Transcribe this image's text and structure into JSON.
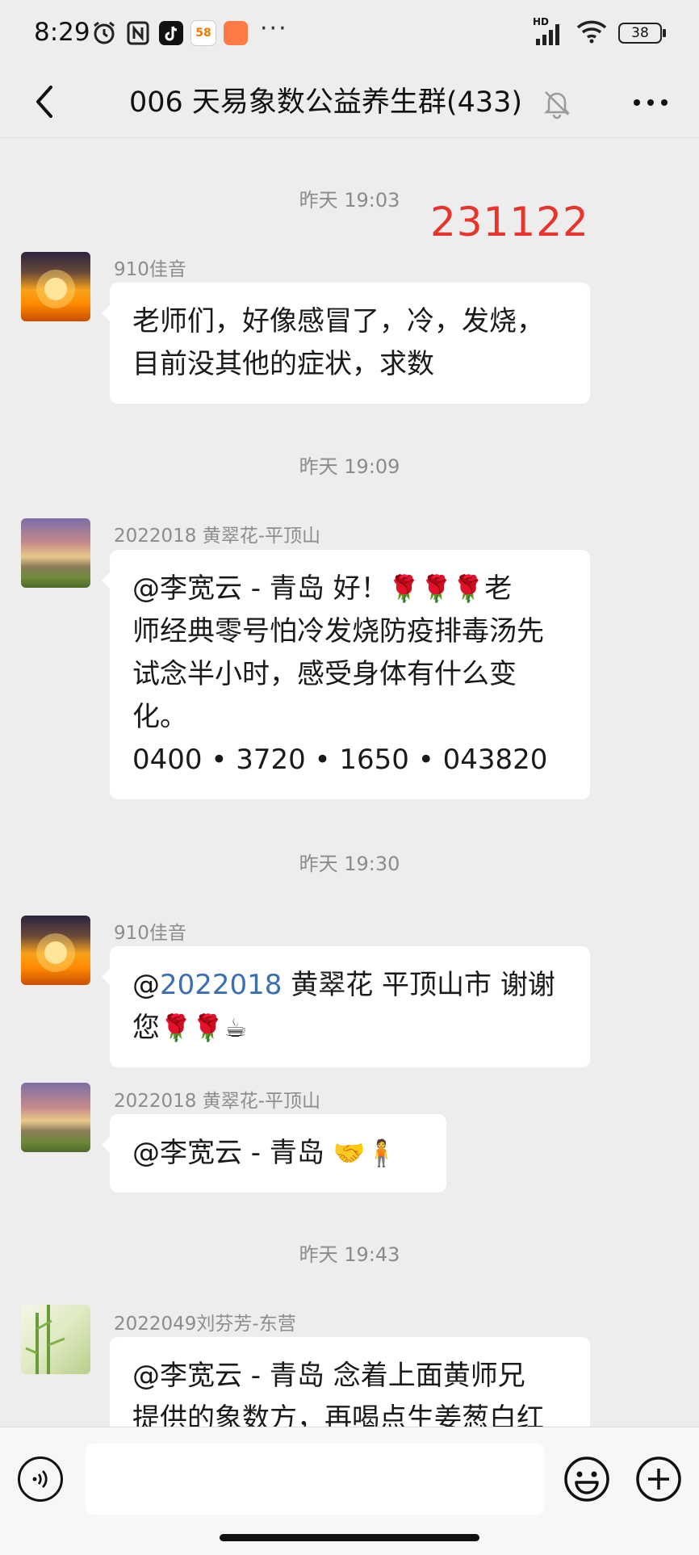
{
  "status_bar": {
    "time": "8:29",
    "app_icon_58": "58",
    "more_dots": "···",
    "network": "HD",
    "battery": "38"
  },
  "header": {
    "title": "006 天易象数公益养生群(433)"
  },
  "overlay": {
    "red_stamp": "231122",
    "red_color": "#e8342a"
  },
  "timestamps": {
    "t1": "昨天 19:03",
    "t2": "昨天 19:09",
    "t3": "昨天 19:30",
    "t4": "昨天 19:43"
  },
  "messages": [
    {
      "sender": "910佳音",
      "line1": "老师们，好像感冒了，冷，发烧，",
      "line2": "目前没其他的症状，求数"
    },
    {
      "sender": "2022018 黄翠花-平顶山",
      "line1_text": "@李宽云 - 青岛  好！",
      "line1_emoji": "🌹🌹🌹",
      "line1_tail": "老",
      "line2": "师经典零号怕冷发烧防疫排毒汤先",
      "line3": "试念半小时，感受身体有什么变",
      "line4": "化。",
      "line5": "0400 • 3720 • 1650 • 043820"
    },
    {
      "sender": "910佳音",
      "mention_at": "@",
      "mention_link": "2022018",
      "line1_tail": " 黄翠花  平顶山市  谢谢",
      "line2_text": "您",
      "line2_emoji": "🌹🌹☕"
    },
    {
      "sender": "2022018 黄翠花-平顶山",
      "text": "@李宽云 - 青岛 ",
      "emoji": "🤝🧍"
    },
    {
      "sender": "2022049刘芬芳-东营",
      "line1": "@李宽云 - 青岛  念着上面黄师兄",
      "line2": "提供的象数方，再喝点生姜葱白红"
    }
  ],
  "icons": {
    "back": "chevron-left-icon",
    "mute": "bell-off-icon",
    "more": "more-icon",
    "voice": "voice-icon",
    "emoji": "emoji-icon",
    "plus": "plus-icon"
  }
}
